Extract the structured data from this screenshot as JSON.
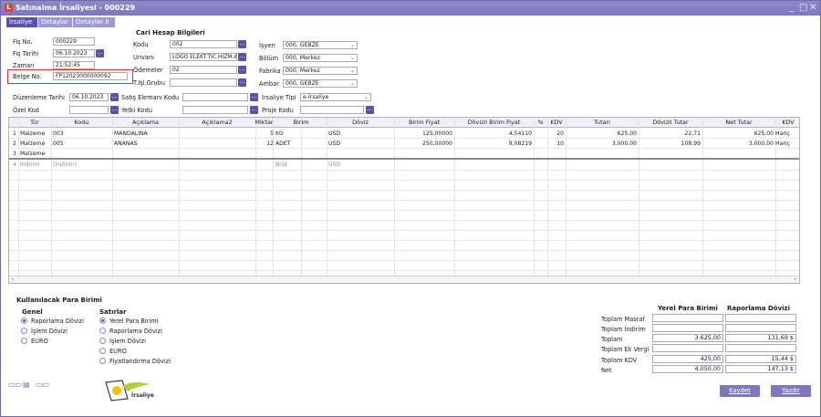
{
  "window": {
    "title": "Satınalma İrsaliyesi - 000229",
    "icon_letter": "L",
    "controls": [
      "_",
      "□",
      "✕"
    ]
  },
  "tabs": [
    {
      "label": "İrsaliye",
      "active": true
    },
    {
      "label": "Detaylar",
      "active": false
    },
    {
      "label": "Detaylar II",
      "active": false
    }
  ],
  "header": {
    "fis_no_label": "Fiş No.",
    "fis_no": "000229",
    "fis_tarihi_label": "Fiş Tarihi",
    "fis_tarihi": "06.10.2023",
    "zaman_label": "Zaman",
    "zaman": "21:52:45",
    "belge_no_label": "Belge No.",
    "belge_no": "FP12023000000092",
    "cari_title": "Cari Hesap Bilgileri",
    "kodu_label": "Kodu",
    "kodu": "002",
    "unvani_label": "Unvanı",
    "unvani": "LOGO ELEKT.TİC.HİZM.A.",
    "odemeler_label": "Ödemeler",
    "odemeler": "02",
    "tisl_label": "T.İşl.Grubu",
    "tisl": "",
    "isyeri_label": "İşyeri",
    "isyeri": "000, GEBZE",
    "bolum_label": "Bölüm",
    "bolum": "000, Merkez",
    "fabrika_label": "Fabrika",
    "fabrika": "000, Merkez",
    "ambar_label": "Ambar",
    "ambar": "000, GEBZE",
    "duzenleme_label": "Düzenleme Tarihi",
    "duzenleme": "06.10.2023",
    "satis_label": "Satış Elemanı Kodu",
    "satis": "",
    "irsaliye_tipi_label": "İrsaliye Tipi",
    "irsaliye_tipi": "e-İrsaliye",
    "ozel_kod_label": "Özel Kod",
    "ozel_kod": "",
    "yetki_label": "Yetki Kodu",
    "yetki": "",
    "proje_label": "Proje Kodu",
    "proje": ""
  },
  "grid": {
    "columns": [
      "Tür",
      "Kodu",
      "Açıklama",
      "Açıklama2",
      "Miktar",
      "Birim",
      "Döviz",
      "Birim Fiyat",
      "Dövizli Birim Fiyat",
      "%",
      "KDV",
      "Tutarı",
      "Dövizli Tutar",
      "Net Tutar",
      "KDV"
    ],
    "rows": [
      {
        "no": "1",
        "tur": "Malzeme",
        "kodu": "003",
        "aciklama": "MANDALİNA",
        "miktar": "5",
        "birim": "KG",
        "doviz": "USD",
        "birim_fiyat": "125,00000",
        "dov_birim_fiyat": "4,54110",
        "kdv": "20",
        "tutar": "625,00",
        "dov_tutar": "22,71",
        "net_tutar": "625,00",
        "kdv2": "Hariç",
        "grey": false
      },
      {
        "no": "2",
        "tur": "Malzeme",
        "kodu": "005",
        "aciklama": "ANANAS",
        "miktar": "12",
        "birim": "ADET",
        "doviz": "USD",
        "birim_fiyat": "250,00000",
        "dov_birim_fiyat": "9,08219",
        "kdv": "10",
        "tutar": "3.000,00",
        "dov_tutar": "108,99",
        "net_tutar": "3.000,00",
        "kdv2": "Hariç",
        "grey": false
      },
      {
        "no": "3",
        "tur": "Malzeme",
        "kodu": "",
        "aciklama": "",
        "miktar": "",
        "birim": "",
        "doviz": "",
        "birim_fiyat": "",
        "dov_birim_fiyat": "",
        "kdv": "",
        "tutar": "",
        "dov_tutar": "",
        "net_tutar": "",
        "kdv2": "",
        "grey": false
      },
      {
        "no": "4",
        "tur": "İndirim",
        "kodu": "(İndirim)",
        "aciklama": "",
        "miktar": "",
        "birim": "Brüt",
        "doviz": "USD",
        "birim_fiyat": "",
        "dov_birim_fiyat": "",
        "kdv": "",
        "tutar": "",
        "dov_tutar": "",
        "net_tutar": "",
        "kdv2": "",
        "grey": true
      }
    ]
  },
  "currency": {
    "title": "Kullanılacak Para Birimi",
    "genel_title": "Genel",
    "genel": [
      {
        "label": "Raporlama Dövizi",
        "selected": true
      },
      {
        "label": "İşlem Dövizi",
        "selected": false
      },
      {
        "label": "EURO",
        "selected": false
      }
    ],
    "satirlar_title": "Satırlar",
    "satirlar": [
      {
        "label": "Yerel Para Birimi",
        "selected": true
      },
      {
        "label": "Raporlama Dövizi",
        "selected": false
      },
      {
        "label": "İşlem Dövizi",
        "selected": false
      },
      {
        "label": "EURO",
        "selected": false
      },
      {
        "label": "Fiyatlandırma Dövizi",
        "selected": false
      }
    ]
  },
  "totals": {
    "col1": "Yerel Para Birimi",
    "col2": "Raporlama Dövizi",
    "rows": [
      {
        "label": "Toplam Masraf",
        "v1": "",
        "v2": ""
      },
      {
        "label": "Toplam İndirim",
        "v1": "",
        "v2": ""
      },
      {
        "label": "Toplam",
        "v1": "3.625,00",
        "v2": "131,69 $"
      },
      {
        "label": "Toplam Ek Vergi",
        "v1": "",
        "v2": ""
      },
      {
        "label": "Toplam KDV",
        "v1": "425,00",
        "v2": "15,44 $"
      },
      {
        "label": "Net",
        "v1": "4.050,00",
        "v2": "147,13 $"
      }
    ]
  },
  "buttons": {
    "save": "Kaydet",
    "print": "Yazdır"
  },
  "logo": {
    "text": "İrsaliye"
  },
  "dots_glyph": "...",
  "chev_glyph": "⌄"
}
